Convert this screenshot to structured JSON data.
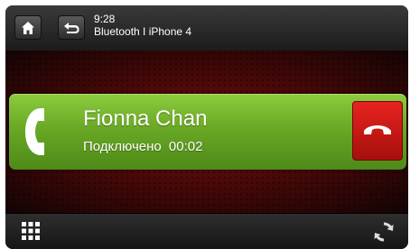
{
  "header": {
    "time": "9:28",
    "connection": "Bluetooth I  iPhone 4",
    "home_icon": "home-icon",
    "back_icon": "back-arrow-icon"
  },
  "call": {
    "caller_name": "Fionna Chan",
    "status_label": "Подключено",
    "duration": "00:02",
    "phone_icon": "phone-handset-icon",
    "hangup_icon": "hang-up-icon",
    "card_color": "#6aa826",
    "hangup_color": "#d41c18"
  },
  "footer": {
    "keypad_icon": "keypad-grid-icon",
    "refresh_icon": "refresh-icon"
  }
}
